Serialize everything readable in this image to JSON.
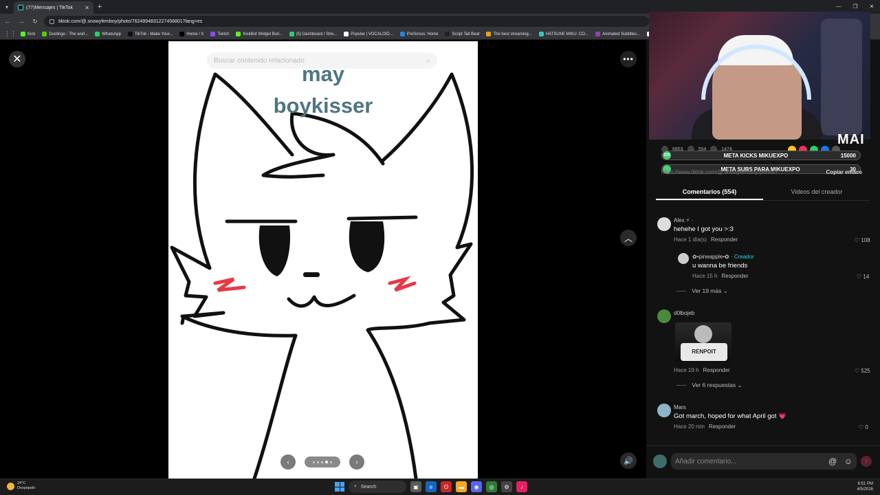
{
  "browser": {
    "tab_title": "(77)Mensajes | TikTok",
    "url": "tiktok.com/@.snowyfemboy/photo/7624994831227456801?lang=es",
    "bookmarks": [
      {
        "label": "Kick",
        "color": "#53fc18"
      },
      {
        "label": "Duolingo - The worl...",
        "color": "#58cc02"
      },
      {
        "label": "WhatsApp",
        "color": "#25d366"
      },
      {
        "label": "TikTok - Make Your...",
        "color": "#111111"
      },
      {
        "label": "Home / X",
        "color": "#000000"
      },
      {
        "label": "Twitch",
        "color": "#9146ff"
      },
      {
        "label": "KickBot Widget Buil...",
        "color": "#53fc18"
      },
      {
        "label": "(5) Dashboard / Stre...",
        "color": "#2ecc71"
      },
      {
        "label": "Popular | VOCALOID...",
        "color": "#ffffff"
      },
      {
        "label": "PreSonus: Home",
        "color": "#1e88e5"
      },
      {
        "label": "Script Tail Beat",
        "color": "#222222"
      },
      {
        "label": "The best streaming...",
        "color": "#f39c12"
      },
      {
        "label": "HATSUNE MIKU: CO...",
        "color": "#39c5bb"
      },
      {
        "label": "Animated Subtitles...",
        "color": "#8e44ad"
      },
      {
        "label": "HAT",
        "color": "#ffffff"
      }
    ]
  },
  "viewer": {
    "search_placeholder": "Buscar contenido relacionado",
    "photo_text_line1": "may",
    "photo_text_line2": "boykisser",
    "close_glyph": "✕",
    "more_glyph": "•••",
    "up_glyph": "︿",
    "volume_glyph": "🔊",
    "prev_glyph": "‹",
    "next_glyph": "›",
    "page_dots": 5,
    "active_dot": 3
  },
  "overlay": {
    "streamer_tag": "MAI",
    "stats": [
      "6853",
      "554",
      "1474"
    ],
    "meta_kicks": {
      "label": "META KICKS MIKUEXPO",
      "value": "15000",
      "badge": "575"
    },
    "meta_subs": {
      "label": "META SUBS PARA MIKUEXPO",
      "value": "30"
    },
    "link_preview": "https://www.tiktok.com/@.snowyfemboy/photo/7...",
    "copy_link": "Copiar enlace"
  },
  "panel": {
    "tabs": [
      "Comentarios (554)",
      "Videos del creador"
    ],
    "reply_label": "Responder",
    "comments": [
      {
        "author": "Alex ⚡ ·",
        "text": "hehehe I got you >:3",
        "time": "Hace 1 día(s)",
        "likes": "108"
      },
      {
        "author": "✿•pineapple•✿ ",
        "creator": "· Creador",
        "text": "u wanna be friends",
        "time": "Hace 15 h",
        "likes": "14",
        "reply": true
      },
      {
        "author": "d0lbojeb",
        "image_text": "RENPOIT",
        "time": "Hace 19 h",
        "likes": "525"
      },
      {
        "author": "Mars",
        "text": "Got march, hoped for what April got 💗",
        "time": "Hace 20 min",
        "likes": "0"
      }
    ],
    "more_replies_1": "Ver 19 más",
    "more_replies_2": "Ver 6 respuestas",
    "input_placeholder": "Añadir comentario...",
    "at_glyph": "@",
    "emoji_glyph": "☺",
    "send_glyph": "↑"
  },
  "taskbar": {
    "temp": "24°C",
    "weather": "Despejado",
    "search": "Search",
    "time": "8:51 PM",
    "date": "4/5/2026"
  }
}
